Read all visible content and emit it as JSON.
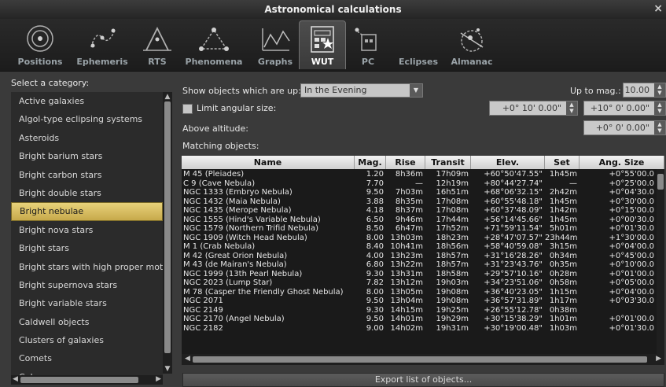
{
  "window": {
    "title": "Astronomical calculations",
    "close_glyph": "×"
  },
  "tabs": [
    {
      "label": "Positions",
      "icon": "positions-icon"
    },
    {
      "label": "Ephemeris",
      "icon": "ephemeris-icon"
    },
    {
      "label": "RTS",
      "icon": "rts-icon"
    },
    {
      "label": "Phenomena",
      "icon": "phenomena-icon"
    },
    {
      "label": "Graphs",
      "icon": "graphs-icon"
    },
    {
      "label": "WUT",
      "icon": "wut-icon"
    },
    {
      "label": "PC",
      "icon": "pc-icon"
    },
    {
      "label": "Eclipses",
      "icon": "eclipses-icon"
    },
    {
      "label": "Almanac",
      "icon": "almanac-icon"
    }
  ],
  "active_tab": "WUT",
  "categories": {
    "label": "Select a category:",
    "items": [
      "Active galaxies",
      "Algol-type eclipsing systems",
      "Asteroids",
      "Bright barium stars",
      "Bright carbon stars",
      "Bright double stars",
      "Bright nebulae",
      "Bright nova stars",
      "Bright stars",
      "Bright stars with high proper moti",
      "Bright supernova stars",
      "Bright variable stars",
      "Caldwell objects",
      "Clusters of galaxies",
      "Comets",
      "Cubewanos"
    ],
    "selected": "Bright nebulae"
  },
  "filters": {
    "show_up_label": "Show objects which are up:",
    "show_up_value": "In the Evening",
    "up_to_mag_label": "Up to mag.:",
    "up_to_mag_value": "10.00",
    "limit_size_label": "Limit angular size:",
    "limit_size_min": "+0° 10' 0.00\"",
    "limit_size_max": "+10° 0' 0.00\"",
    "above_alt_label": "Above altitude:",
    "above_alt_value": "+0° 0' 0.00\"",
    "matching_label": "Matching objects:"
  },
  "table": {
    "headers": [
      "Name",
      "Mag.",
      "Rise",
      "Transit",
      "Elev.",
      "Set",
      "Ang. Size"
    ],
    "rows": [
      [
        "M 45 (Pleiades)",
        "1.20",
        "8h36m",
        "17h09m",
        "+60°50'47.55\"",
        "1h45m",
        "+0°55'00.0"
      ],
      [
        "C 9 (Cave Nebula)",
        "7.70",
        "—",
        "12h19m",
        "+80°44'27.74\"",
        "—",
        "+0°25'00.0"
      ],
      [
        "NGC 1333 (Embryo Nebula)",
        "9.50",
        "7h03m",
        "16h51m",
        "+68°06'32.15\"",
        "2h42m",
        "+0°04'30.0"
      ],
      [
        "NGC 1432 (Maia Nebula)",
        "3.88",
        "8h35m",
        "17h08m",
        "+60°55'48.18\"",
        "1h45m",
        "+0°30'00.0"
      ],
      [
        "NGC 1435 (Merope Nebula)",
        "4.18",
        "8h37m",
        "17h08m",
        "+60°37'48.09\"",
        "1h42m",
        "+0°15'00.0"
      ],
      [
        "NGC 1555 (Hind's Variable Nebula)",
        "6.50",
        "9h46m",
        "17h44m",
        "+56°14'45.66\"",
        "1h45m",
        "+0°00'30.0"
      ],
      [
        "NGC 1579 (Northern Trifid Nebula)",
        "8.50",
        "6h47m",
        "17h52m",
        "+71°59'11.54\"",
        "5h01m",
        "+0°01'30.0"
      ],
      [
        "NGC 1909 (Witch Head Nebula)",
        "8.00",
        "13h03m",
        "18h23m",
        "+28°47'07.57\"",
        "23h44m",
        "+1°30'00.0"
      ],
      [
        "M 1 (Crab Nebula)",
        "8.40",
        "10h41m",
        "18h56m",
        "+58°40'59.08\"",
        "3h15m",
        "+0°04'00.0"
      ],
      [
        "M 42 (Great Orion Nebula)",
        "4.00",
        "13h23m",
        "18h57m",
        "+31°16'28.26\"",
        "0h34m",
        "+0°45'00.0"
      ],
      [
        "M 43 (de Mairan's Nebula)",
        "6.80",
        "13h22m",
        "18h57m",
        "+31°23'43.76\"",
        "0h35m",
        "+0°10'00.0"
      ],
      [
        "NGC 1999 (13th Pearl Nebula)",
        "9.30",
        "13h31m",
        "18h58m",
        "+29°57'10.16\"",
        "0h28m",
        "+0°01'00.0"
      ],
      [
        "NGC 2023 (Lump Star)",
        "7.82",
        "13h12m",
        "19h03m",
        "+34°23'51.06\"",
        "0h58m",
        "+0°05'00.0"
      ],
      [
        "M 78 (Casper the Friendly Ghost Nebula)",
        "8.00",
        "13h05m",
        "19h08m",
        "+36°40'23.05\"",
        "1h15m",
        "+0°04'00.0"
      ],
      [
        "NGC 2071",
        "9.50",
        "13h04m",
        "19h08m",
        "+36°57'31.89\"",
        "1h17m",
        "+0°03'30.0"
      ],
      [
        "NGC 2149",
        "9.30",
        "14h15m",
        "19h25m",
        "+26°55'12.78\"",
        "0h38m",
        ""
      ],
      [
        "NGC 2170 (Angel Nebula)",
        "9.50",
        "14h01m",
        "19h29m",
        "+30°15'38.29\"",
        "1h01m",
        "+0°01'00.0"
      ],
      [
        "NGC 2182",
        "9.00",
        "14h02m",
        "19h31m",
        "+30°19'00.48\"",
        "1h03m",
        "+0°01'30.0"
      ]
    ]
  },
  "export_button": "Export list of objects..."
}
